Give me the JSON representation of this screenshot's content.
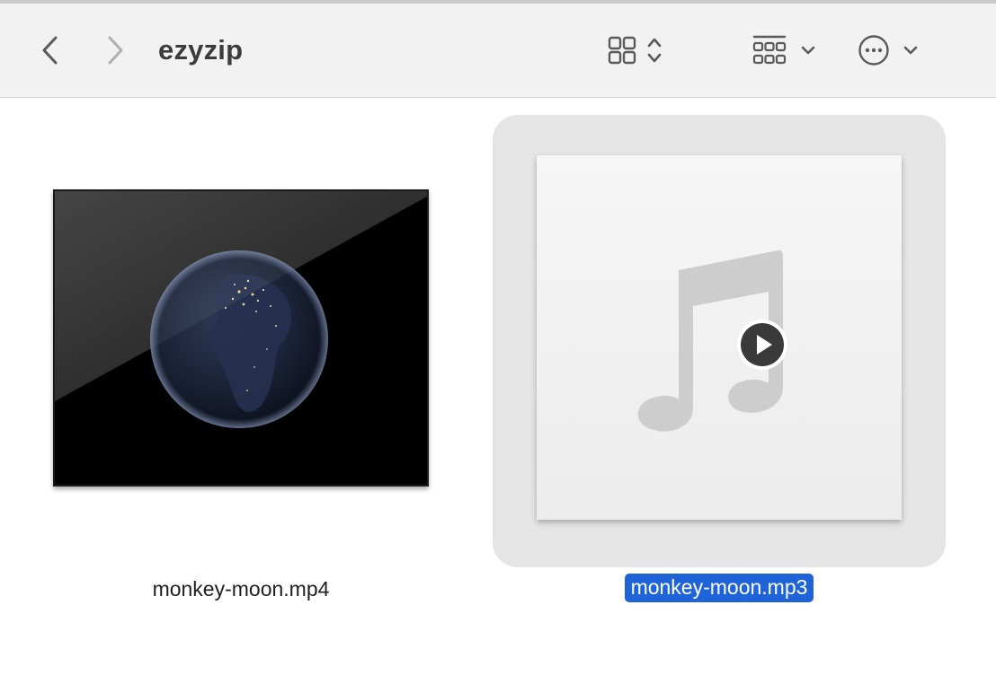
{
  "window": {
    "title": "ezyzip"
  },
  "toolbar": {
    "back_icon": "chevron-left-icon",
    "forward_icon": "chevron-right-icon",
    "view_icon": "grid-view-icon",
    "group_icon": "group-by-icon",
    "more_icon": "ellipsis-circle-icon"
  },
  "files": [
    {
      "name": "monkey-moon.mp4",
      "kind": "video",
      "selected": false
    },
    {
      "name": "monkey-moon.mp3",
      "kind": "audio",
      "selected": true
    }
  ],
  "colors": {
    "selection": "#1f63d8",
    "selected_bg": "#e5e5e5",
    "toolbar_bg": "#f2f2f2"
  }
}
